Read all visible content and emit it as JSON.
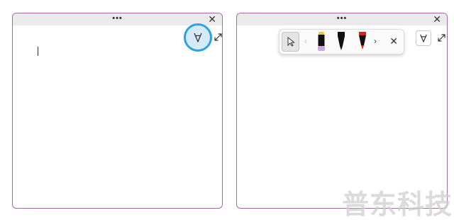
{
  "left_window": {
    "titlebar_dots": "•••",
    "close_glyph": "✕",
    "pen_button_state": "highlighted"
  },
  "right_window": {
    "titlebar_dots": "•••",
    "close_glyph": "✕",
    "toolbar": {
      "prev_glyph": "‹",
      "next_glyph": "›",
      "close_glyph": "✕",
      "pens": [
        {
          "icon": "highlighter-pen-icon",
          "tip_color": "#111111",
          "band_color": "#f2c14e",
          "body_color": "#c9a6e8"
        },
        {
          "icon": "black-pen-icon",
          "tip_color": "#111111",
          "band_color": "#111111",
          "body_color": "#111111"
        },
        {
          "icon": "red-pen-icon",
          "tip_color": "#111111",
          "band_color": "#e02020",
          "body_color": "#111111"
        }
      ]
    }
  },
  "colors": {
    "window_border": "#a56aa9",
    "titlebar": "#ebebeb",
    "highlight_ring": "#2aa3e0",
    "highlight_fill": "#d4eaf7"
  },
  "watermark": "普东科技"
}
